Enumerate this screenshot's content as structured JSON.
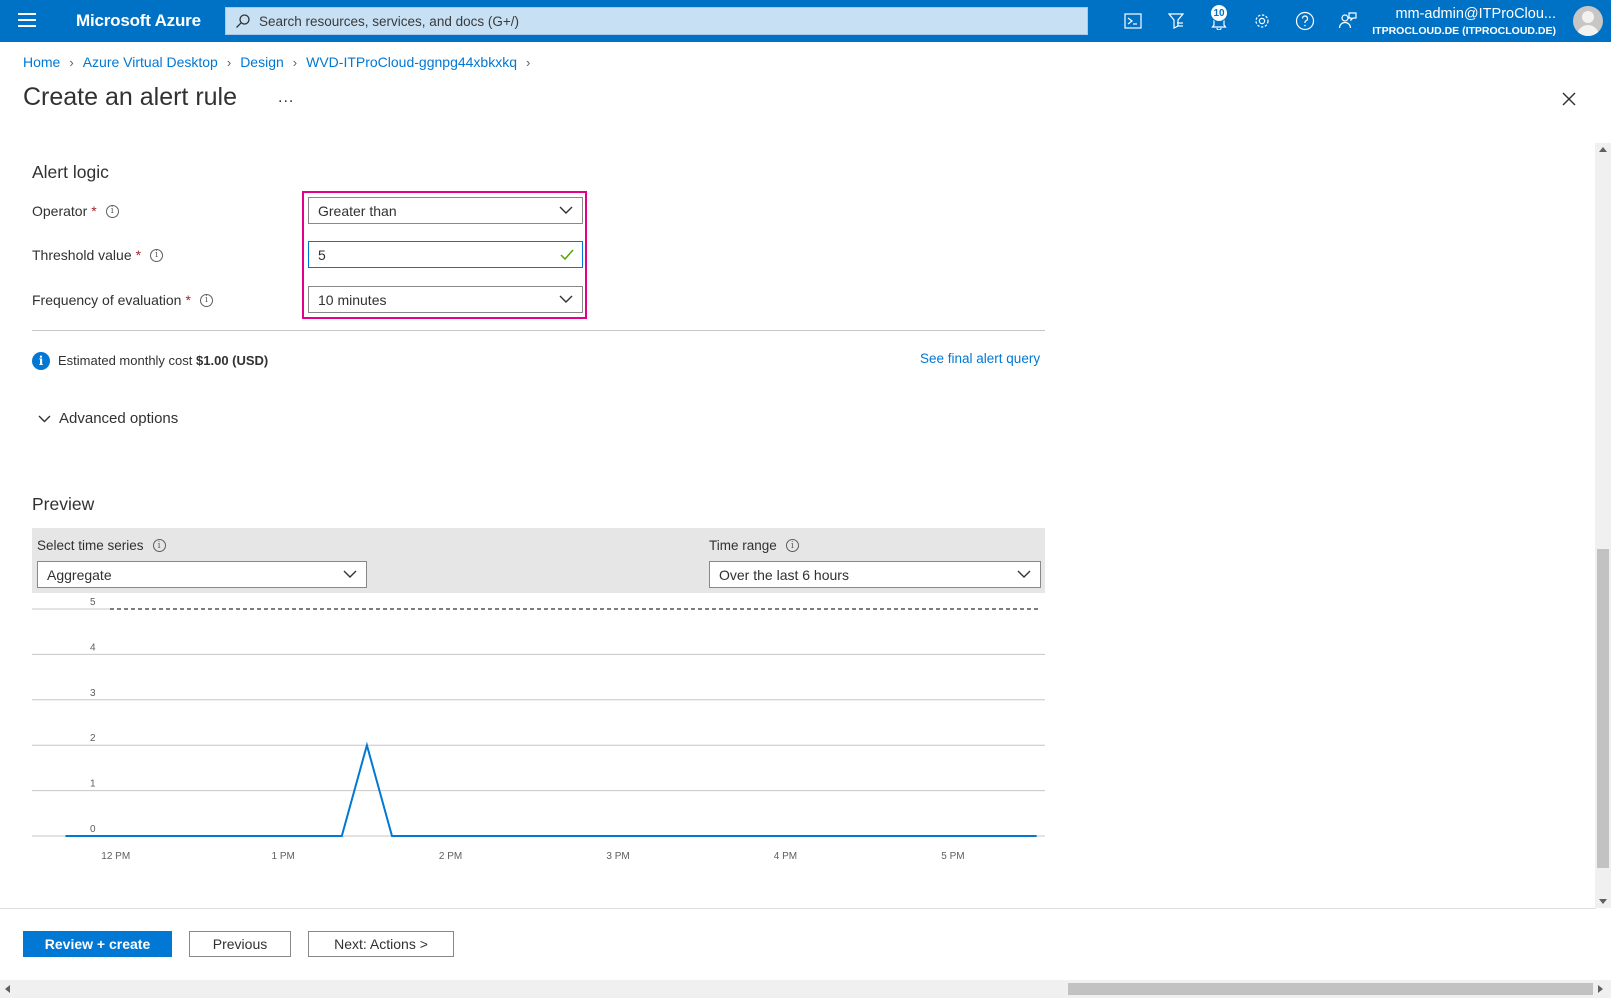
{
  "topbar": {
    "brand": "Microsoft Azure",
    "search_placeholder": "Search resources, services, and docs (G+/)",
    "notification_count": "10",
    "account_name": "mm-admin@ITProClou...",
    "account_directory": "ITPROCLOUD.DE (ITPROCLOUD.DE)",
    "icons": [
      "cloud-shell-icon",
      "directory-filter-icon",
      "notifications-icon",
      "settings-icon",
      "help-icon",
      "feedback-icon"
    ]
  },
  "breadcrumb": [
    "Home",
    "Azure Virtual Desktop",
    "Design",
    "WVD-ITProCloud-ggnpg44xbkxkq"
  ],
  "page": {
    "title": "Create an alert rule",
    "more": "..."
  },
  "alert_logic": {
    "title": "Alert logic",
    "operator_label": "Operator",
    "operator_value": "Greater than",
    "threshold_label": "Threshold value",
    "threshold_value": "5",
    "frequency_label": "Frequency of evaluation",
    "frequency_value": "10 minutes",
    "required_mark": "*"
  },
  "cost": {
    "prefix": "Estimated monthly cost",
    "amount": "$1.00 (USD)",
    "query_link": "See final alert query"
  },
  "advanced": {
    "label": "Advanced options"
  },
  "preview": {
    "title": "Preview",
    "series_label": "Select time series",
    "series_value": "Aggregate",
    "time_label": "Time range",
    "time_value": "Over the last 6 hours"
  },
  "chart_data": {
    "type": "line",
    "x": [
      11.7,
      12.0,
      12.5,
      13.0,
      13.35,
      13.5,
      13.65,
      14.0,
      14.5,
      15.0,
      15.5,
      16.0,
      16.5,
      17.0,
      17.5
    ],
    "series": [
      {
        "values": [
          0,
          0,
          0,
          0,
          0,
          2,
          0,
          0,
          0,
          0,
          0,
          0,
          0,
          0,
          0
        ]
      }
    ],
    "threshold": 5,
    "xticks": [
      {
        "value": 12,
        "label": "12 PM"
      },
      {
        "value": 13,
        "label": "1 PM"
      },
      {
        "value": 14,
        "label": "2 PM"
      },
      {
        "value": 15,
        "label": "3 PM"
      },
      {
        "value": 16,
        "label": "4 PM"
      },
      {
        "value": 17,
        "label": "5 PM"
      }
    ],
    "yticks": [
      "0",
      "1",
      "2",
      "3",
      "4",
      "5"
    ],
    "xlim": [
      11.5,
      17.55
    ],
    "ylim": [
      0,
      5
    ],
    "grid": true,
    "colors": {
      "line": "#0078d4",
      "threshold": "#323130",
      "grid": "#c8c6c4"
    }
  },
  "buttons": {
    "review_create": "Review + create",
    "previous": "Previous",
    "next": "Next: Actions >"
  }
}
